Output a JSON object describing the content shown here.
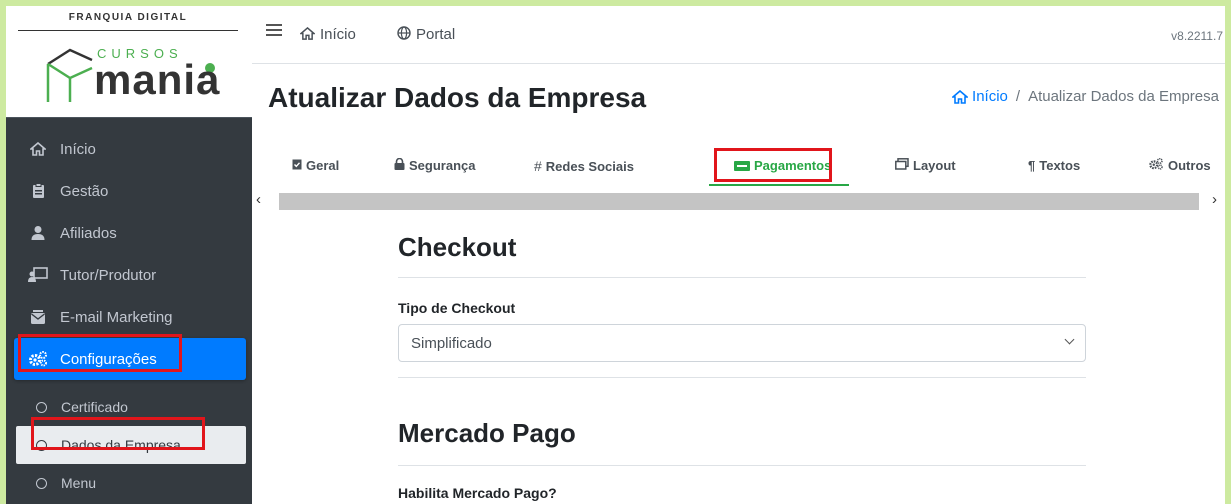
{
  "brand": {
    "tagline_prefix": "FRANQUIA",
    "tagline_bold": "DIGITAL",
    "logo_small": "CURSOS",
    "logo_big": "mania"
  },
  "sidebar": {
    "items": [
      {
        "label": "Início",
        "icon": "home-icon"
      },
      {
        "label": "Gestão",
        "icon": "clipboard-icon"
      },
      {
        "label": "Afiliados",
        "icon": "users-icon"
      },
      {
        "label": "Tutor/Produtor",
        "icon": "chalkboard-teacher-icon"
      },
      {
        "label": "E-mail Marketing",
        "icon": "mail-bulk-icon"
      },
      {
        "label": "Configurações",
        "icon": "cogs-icon"
      }
    ],
    "subitems": [
      {
        "label": "Certificado"
      },
      {
        "label": "Dados da Empresa"
      },
      {
        "label": "Menu"
      }
    ]
  },
  "topbar": {
    "home": "Início",
    "portal": "Portal",
    "version": "v8.2211.7"
  },
  "page": {
    "title": "Atualizar Dados da Empresa",
    "breadcrumb_home": "Início",
    "breadcrumb_sep": "/",
    "breadcrumb_current": "Atualizar Dados da Empresa"
  },
  "tabs": [
    {
      "label": "Geral"
    },
    {
      "label": "Segurança"
    },
    {
      "label": "Redes Sociais"
    },
    {
      "label": "Pagamentos"
    },
    {
      "label": "Layout"
    },
    {
      "label": "Textos"
    },
    {
      "label": "Outros"
    }
  ],
  "form": {
    "checkout_heading": "Checkout",
    "checkout_type_label": "Tipo de Checkout",
    "checkout_type_value": "Simplificado",
    "mp_heading": "Mercado Pago",
    "mp_enable_label": "Habilita Mercado Pago?"
  },
  "colors": {
    "accent": "#007bff",
    "highlight": "#e1151b",
    "tab_active": "#28a745",
    "sidebar_bg": "#343a40"
  }
}
